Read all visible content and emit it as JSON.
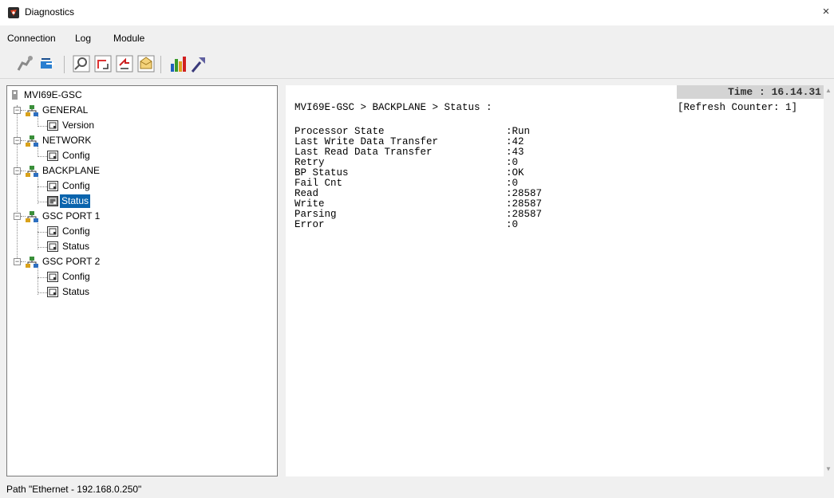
{
  "window": {
    "title": "Diagnostics",
    "close_glyph": "×"
  },
  "menu": [
    "Connection",
    "Log",
    "Module"
  ],
  "toolbar": {
    "buttons": [
      "disconnect-icon",
      "connect-icon",
      "inspect-icon",
      "capture-icon",
      "transfer-icon",
      "message-icon",
      "bar-chart-icon",
      "settings-icon"
    ]
  },
  "tree": {
    "root": "MVI69E-GSC",
    "groups": [
      {
        "label": "GENERAL",
        "items": [
          "Version"
        ]
      },
      {
        "label": "NETWORK",
        "items": [
          "Config"
        ]
      },
      {
        "label": "BACKPLANE",
        "items": [
          "Config",
          "Status"
        ]
      },
      {
        "label": "GSC PORT 1",
        "items": [
          "Config",
          "Status"
        ]
      },
      {
        "label": "GSC PORT 2",
        "items": [
          "Config",
          "Status"
        ]
      }
    ],
    "selected": "BACKPLANE > Status"
  },
  "status": {
    "time": "Time : 16.14.31",
    "path": "MVI69E-GSC > BACKPLANE > Status :",
    "counter": "[Refresh Counter: 1]",
    "rows": [
      {
        "key": "Processor State",
        "value": ":Run"
      },
      {
        "key": "Last Write Data Transfer",
        "value": ":42"
      },
      {
        "key": "Last Read Data Transfer",
        "value": ":43"
      },
      {
        "key": "Retry",
        "value": ":0"
      },
      {
        "key": "BP Status",
        "value": ":OK"
      },
      {
        "key": "Fail Cnt",
        "value": ":0"
      },
      {
        "key": "Read",
        "value": ":28587"
      },
      {
        "key": "Write",
        "value": ":28587"
      },
      {
        "key": "Parsing",
        "value": ":28587"
      },
      {
        "key": "Error",
        "value": ":0"
      }
    ]
  },
  "statusbar": {
    "text": "Path \"Ethernet - 192.168.0.250\""
  },
  "colors": {
    "selection": "#0a64ad",
    "time_bg": "#d4d4d4"
  }
}
